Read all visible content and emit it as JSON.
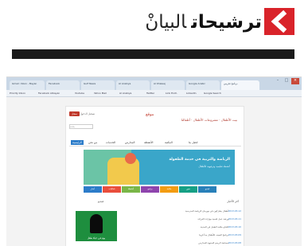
{
  "header": {
    "title": "ترشيحات",
    "brand": "البيانْ",
    "accent": "#d9232a"
  },
  "browser": {
    "tabs": [
      "Gmail: Inbox - Bayan",
      "Facebook",
      "Gulf News",
      "Al Arabiya",
      "Al Khaleej",
      "Google Arabic",
      "برنامج تجريبي"
    ],
    "bookmarks": [
      "Priority Inbox",
      "Facebook Albayan",
      "Youtube",
      "Yahoo Mail",
      "Al Arabiya",
      "Twitter",
      "Link Exch.",
      "LinkedIn",
      "Google Search"
    ]
  },
  "website": {
    "logo": "موقع",
    "tagline": "بيت الأطفال · مشروعات الأطفال · أطفالنا",
    "login_label": "تسجيل الدخول",
    "register_label": "سجل",
    "search_placeholder": "بحث",
    "nav": [
      "الرئيسية",
      "من نحن",
      "الخدمات",
      "المدارس",
      "الأنشطة",
      "المكتبة",
      "اتصل بنا"
    ],
    "banner_title": "الرياضة والتربية في خدمة الطفولة",
    "banner_sub": "أنشطة تعليمية وترفيهية للأطفال",
    "tabs": [
      {
        "label": "أخبار",
        "color": "#2c7cc9"
      },
      {
        "label": "فعاليات",
        "color": "#e94e3c"
      },
      {
        "label": "أنشطة",
        "color": "#7ab648"
      },
      {
        "label": "برامج",
        "color": "#8e44ad"
      },
      {
        "label": "مكتبة",
        "color": "#f39c12"
      },
      {
        "label": "صور",
        "color": "#16a085"
      },
      {
        "label": "فيديو",
        "color": "#2980b9"
      }
    ],
    "news_title": "آخر الأخبار",
    "video_title": "فيديو",
    "news": [
      {
        "date": "2013-03-12",
        "text": "أطفال يشاركون في مهرجان الرياضة المدرسية"
      },
      {
        "date": "2013-03-11",
        "text": "ورشة عمل لتنمية مهارات القراءة"
      },
      {
        "date": "2013-03-10",
        "text": "افتتاح مكتبة الطفل في المدينة"
      },
      {
        "date": "2013-03-09",
        "text": "برنامج الصيف للأطفال يبدأ قريبا"
      },
      {
        "date": "2013-03-08",
        "text": "مسابقة الرسم السنوية للمدارس"
      }
    ],
    "video_caption": "يوم في حياة طفل"
  }
}
